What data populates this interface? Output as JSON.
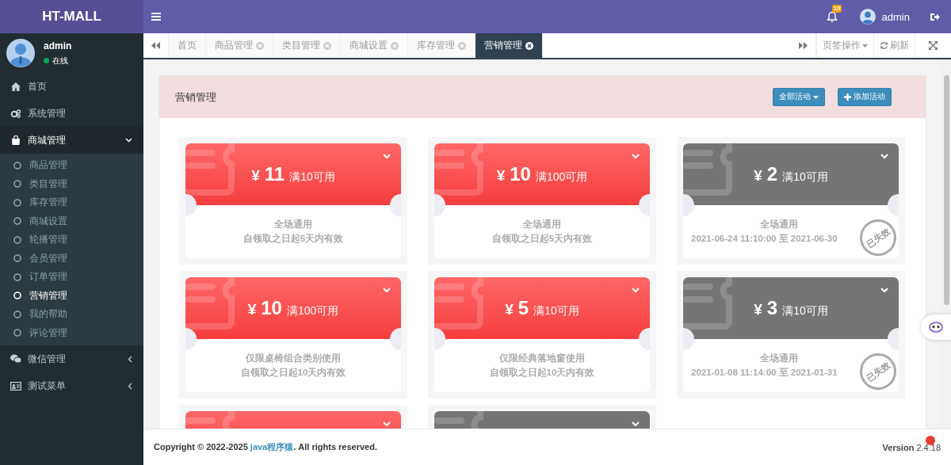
{
  "header": {
    "logo": "HT-MALL",
    "notification_count": "10",
    "user": "admin"
  },
  "sidebar": {
    "user": {
      "name": "admin",
      "status": "在线",
      "online": true
    },
    "menu": [
      {
        "label": "首页"
      },
      {
        "label": "系统管理"
      },
      {
        "label": "商城管理",
        "expanded": true,
        "children": [
          {
            "label": "商品管理",
            "selected": false
          },
          {
            "label": "类目管理",
            "selected": false
          },
          {
            "label": "库存管理",
            "selected": false
          },
          {
            "label": "商城设置",
            "selected": false
          },
          {
            "label": "轮播管理",
            "selected": false
          },
          {
            "label": "会员管理",
            "selected": false
          },
          {
            "label": "订单管理",
            "selected": false
          },
          {
            "label": "营销管理",
            "selected": true
          },
          {
            "label": "我的帮助",
            "selected": false
          },
          {
            "label": "评论管理",
            "selected": false
          }
        ]
      },
      {
        "label": "微信管理",
        "expanded": false
      },
      {
        "label": "测试菜单",
        "expanded": false
      }
    ]
  },
  "tabs": [
    {
      "label": "首页",
      "closable": false,
      "selected": false
    },
    {
      "label": "商品管理",
      "closable": true,
      "selected": false
    },
    {
      "label": "类目管理",
      "closable": true,
      "selected": false
    },
    {
      "label": "商城设置",
      "closable": true,
      "selected": false
    },
    {
      "label": "库存管理",
      "closable": true,
      "selected": false
    },
    {
      "label": "营销管理",
      "closable": true,
      "selected": true
    }
  ],
  "tab_tools": {
    "operations": "页签操作",
    "refresh": "刷新"
  },
  "panel": {
    "title": "营销管理",
    "filter_button": "全部活动",
    "add_button": "添加活动"
  },
  "coupons": [
    {
      "kind": "active",
      "symbol": "¥",
      "amount": "11",
      "condition": "满10可用",
      "scope": "全场通用",
      "validity": "自领取之日起5天内有效"
    },
    {
      "kind": "active",
      "symbol": "¥",
      "amount": "10",
      "condition": "满100可用",
      "scope": "全场通用",
      "validity": "自领取之日起5天内有效"
    },
    {
      "kind": "expired",
      "symbol": "¥",
      "amount": "2",
      "condition": "满10可用",
      "scope": "全场通用",
      "validity": "2021-06-24 11:10:00 至 2021-06-30",
      "stamp": "已失效"
    },
    {
      "kind": "active",
      "symbol": "¥",
      "amount": "10",
      "condition": "满100可用",
      "scope": "仅限桌椅组合类别使用",
      "validity": "自领取之日起10天内有效"
    },
    {
      "kind": "active",
      "symbol": "¥",
      "amount": "5",
      "condition": "满10可用",
      "scope": "仅限经典落地窗使用",
      "validity": "自领取之日起10天内有效"
    },
    {
      "kind": "expired",
      "symbol": "¥",
      "amount": "3",
      "condition": "满10可用",
      "scope": "全场通用",
      "validity": "2021-01-08 11:14:00 至 2021-01-31",
      "stamp": "已失效"
    },
    {
      "kind": "active"
    },
    {
      "kind": "expired"
    }
  ],
  "footer": {
    "copyright_before": "Copyright © 2022-2025 ",
    "copyright_link": "java程序猿",
    "copyright_after": ". All rights reserved.",
    "version": "**Version** 2.4.18"
  }
}
